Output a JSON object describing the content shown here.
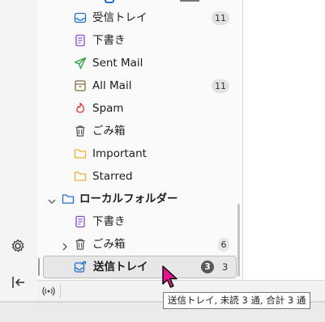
{
  "folders": [
    {
      "label": "受信トレイ",
      "icon": "inbox-icon",
      "badge": "11"
    },
    {
      "label": "下書き",
      "icon": "drafts-icon",
      "badge": ""
    },
    {
      "label": "Sent Mail",
      "icon": "sent-icon",
      "badge": ""
    },
    {
      "label": "All Mail",
      "icon": "archive-icon",
      "badge": "11"
    },
    {
      "label": "Spam",
      "icon": "spam-icon",
      "badge": ""
    },
    {
      "label": "ごみ箱",
      "icon": "trash-icon",
      "badge": ""
    },
    {
      "label": "Important",
      "icon": "folder-icon",
      "badge": ""
    },
    {
      "label": "Starred",
      "icon": "folder-icon",
      "badge": ""
    }
  ],
  "local": {
    "label": "ローカルフォルダー",
    "drafts": "下書き",
    "trash": "ごみ箱",
    "trash_badge": "6",
    "outbox": "送信トレイ",
    "outbox_unread": "3",
    "outbox_total": "3"
  },
  "tooltip": "送信トレイ, 未読 3 通, 合計 3 通",
  "colors": {
    "accent": "#1f6fd1",
    "sent": "#2ea043",
    "drafts": "#8a4ad0",
    "spam": "#e0342f",
    "folder": "#e9b432"
  }
}
